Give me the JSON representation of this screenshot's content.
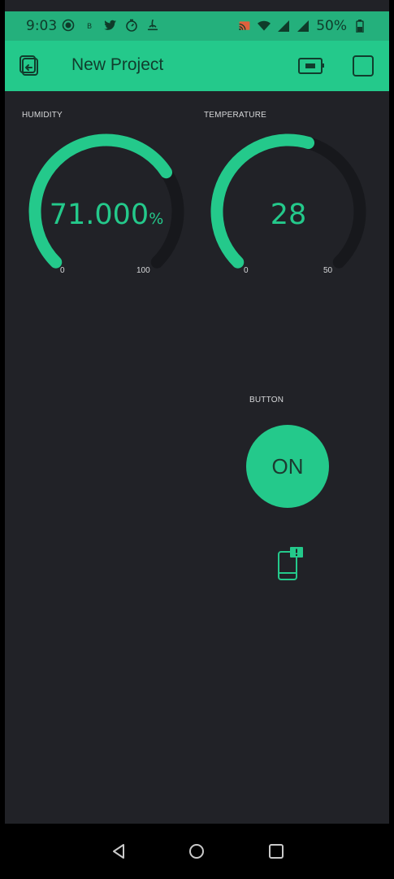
{
  "status_bar": {
    "time": "9:03",
    "battery": "50%",
    "icons_left": [
      "record-icon",
      "data-indicator-icon",
      "twitter-icon",
      "timer-icon",
      "app-icon"
    ],
    "icons_right": [
      "cast-icon",
      "wifi-icon",
      "signal-icon",
      "signal-icon",
      "battery-icon"
    ]
  },
  "app_bar": {
    "title": "New Project",
    "back_icon": "exit-project-icon",
    "device_icon": "device-icon",
    "stop_icon": "stop-icon"
  },
  "widgets": {
    "humidity": {
      "label": "HUMIDITY",
      "value": "71.000",
      "unit": "%",
      "min": "0",
      "max": "100",
      "numeric_value": 71,
      "min_num": 0,
      "max_num": 100
    },
    "temperature": {
      "label": "TEMPERATURE",
      "value": "28",
      "min": "0",
      "max": "50",
      "numeric_value": 28,
      "min_num": 0,
      "max_num": 50
    },
    "button": {
      "label": "BUTTON",
      "state": "ON"
    },
    "device_status_icon": "device-offline-alert-icon"
  },
  "nav_bar": {
    "back": "back-icon",
    "home": "home-icon",
    "recents": "recents-icon"
  },
  "colors": {
    "accent": "#24c98b",
    "status_bar": "#24b07c",
    "background": "#212227",
    "track": "#17181c",
    "label": "#d7d8da"
  }
}
